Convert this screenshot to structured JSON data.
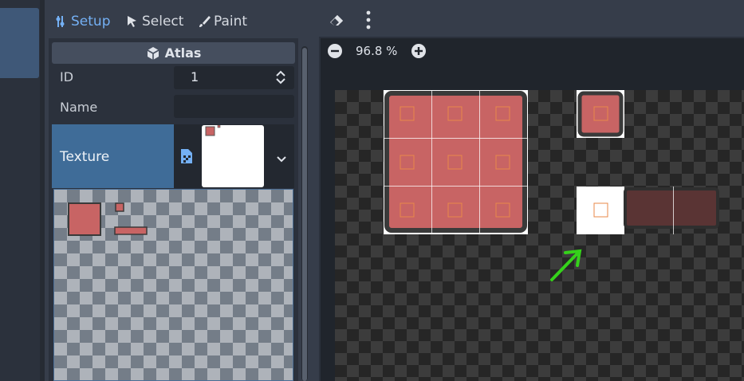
{
  "toolbar": {
    "setup_label": "Setup",
    "select_label": "Select",
    "paint_label": "Paint",
    "accent": "#74b0f4"
  },
  "inspector": {
    "header": "Atlas",
    "id_label": "ID",
    "id_value": "1",
    "name_label": "Name",
    "name_value": "",
    "texture_label": "Texture"
  },
  "editor": {
    "zoom_label": "96.8 %"
  },
  "colors": {
    "tile_fill": "#c86464",
    "tile_border": "#3a3a3a",
    "selection": "#4c6f96",
    "annotation_arrow": "#35d11b"
  },
  "icons": [
    "setup-icon",
    "select-cursor-icon",
    "paint-brush-icon",
    "eraser-icon",
    "more-vertical-icon",
    "atlas-cube-icon",
    "spinner-arrows-icon",
    "texture-file-icon",
    "chevron-down-icon",
    "zoom-out-icon",
    "zoom-in-icon"
  ]
}
